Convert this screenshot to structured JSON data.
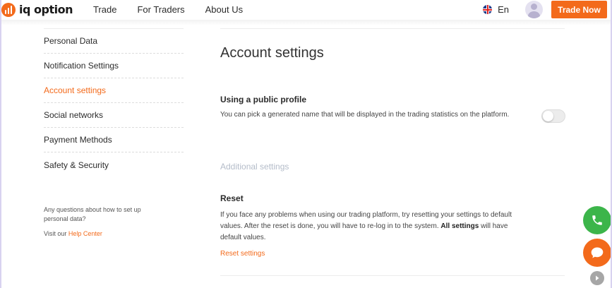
{
  "brand": {
    "name": "iq option",
    "accent": "#f36a1b"
  },
  "nav": {
    "items": [
      {
        "label": "Trade"
      },
      {
        "label": "For Traders"
      },
      {
        "label": "About Us"
      }
    ]
  },
  "header": {
    "language": "En",
    "trade_button": "Trade Now"
  },
  "sidebar": {
    "items": [
      {
        "label": "Personal Data"
      },
      {
        "label": "Notification Settings"
      },
      {
        "label": "Account settings",
        "active": true
      },
      {
        "label": "Social networks"
      },
      {
        "label": "Payment Methods"
      },
      {
        "label": "Safety & Security"
      }
    ],
    "help_text": "Any questions about how to set up personal data?",
    "help_prefix": "Visit our",
    "help_link": "Help Center"
  },
  "main": {
    "title": "Account settings",
    "public_profile": {
      "title": "Using a public profile",
      "description": "You can pick a generated name that will be displayed in the trading statistics on the platform.",
      "enabled": false
    },
    "additional_label": "Additional settings",
    "reset": {
      "title": "Reset",
      "description_1": "If you face any problems when using our trading platform, try resetting your settings to default values. After the reset is done, you will have to re-log in to the system.",
      "description_bold": "All settings",
      "description_2": "will have default values.",
      "link": "Reset settings"
    }
  },
  "colors": {
    "accent": "#f36a1b",
    "call_button": "#3cb54a",
    "muted_text": "#b4bcc9"
  },
  "icons": [
    "logo-icon",
    "uk-flag-icon",
    "avatar-icon",
    "phone-icon",
    "chat-icon",
    "chevron-right-icon"
  ]
}
